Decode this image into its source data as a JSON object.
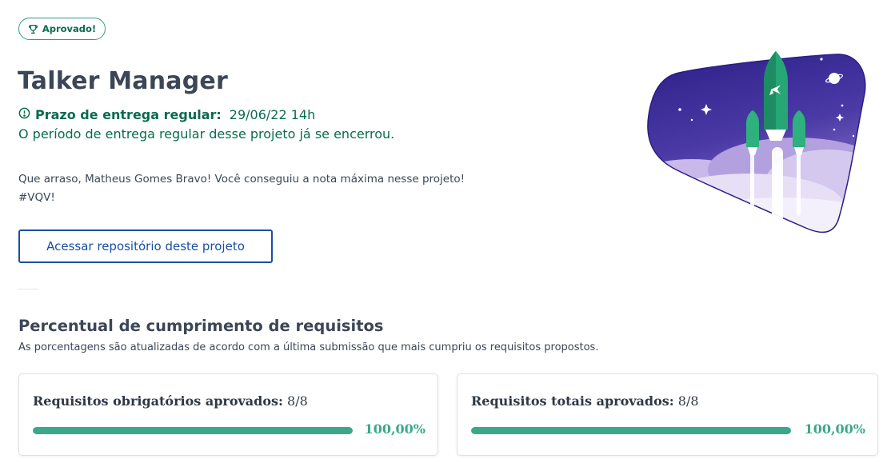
{
  "status_badge": {
    "label": "Aprovado!",
    "icon": "trophy-icon",
    "color": "#0a6b4f"
  },
  "project": {
    "title": "Talker Manager",
    "deadline_label": "Prazo de entrega regular:",
    "deadline_value": "29/06/22 14h",
    "deadline_message": "O período de entrega regular desse projeto já se encerrou.",
    "congrats_line1": "Que arraso, Matheus Gomes Bravo! Você conseguiu a nota máxima nesse projeto!",
    "congrats_line2": "#VQV!",
    "repo_button_label": "Acessar repositório deste projeto"
  },
  "requirements": {
    "title": "Percentual de cumprimento de requisitos",
    "subtitle": "As porcentagens são atualizadas de acordo com a última submissão que mais cumpriu os requisitos propostos.",
    "mandatory": {
      "label": "Requisitos obrigatórios aprovados:",
      "count": "8/8",
      "percent_text": "100,00%",
      "progress": 1.0
    },
    "total": {
      "label": "Requisitos totais aprovados:",
      "count": "8/8",
      "percent_text": "100,00%",
      "progress": 1.0
    }
  },
  "colors": {
    "accent_green": "#0a6b4f",
    "progress_green": "#3aa889",
    "link_blue": "#1a4fa3",
    "illustration_purple": "#3a2a8c"
  },
  "icons": {
    "deadline": "alert-circle-icon",
    "illustration": "rocket-illustration"
  }
}
